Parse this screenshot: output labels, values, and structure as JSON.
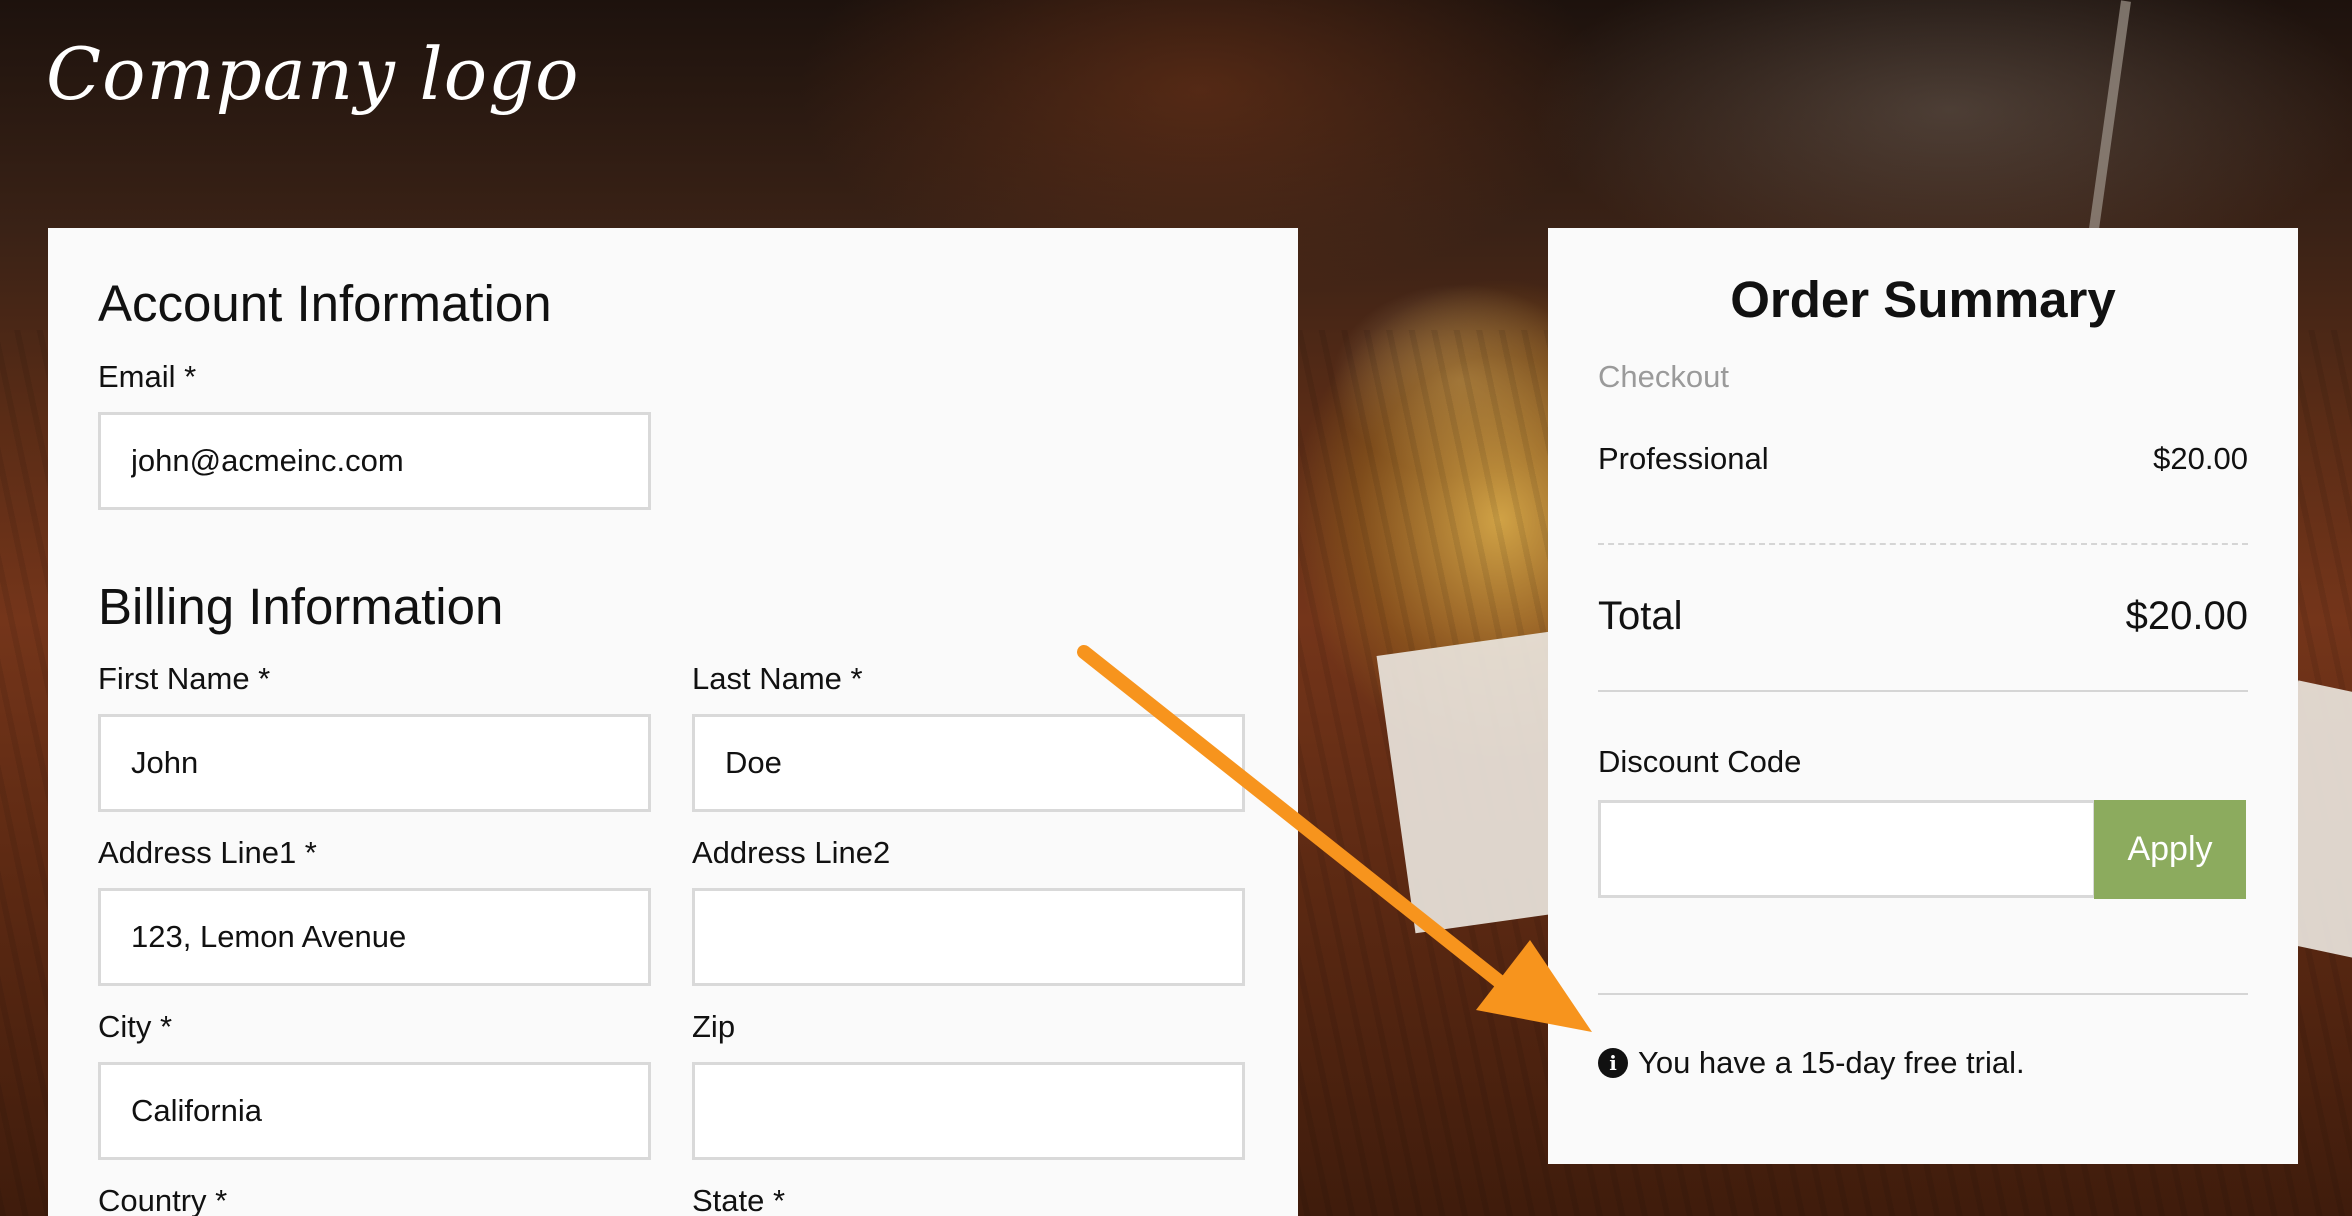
{
  "brand": {
    "logo_text": "Company logo"
  },
  "account": {
    "title": "Account Information",
    "email_label": "Email *",
    "email_value": "john@acmeinc.com"
  },
  "billing": {
    "title": "Billing Information",
    "first_name_label": "First Name *",
    "first_name_value": "John",
    "last_name_label": "Last Name *",
    "last_name_value": "Doe",
    "address1_label": "Address Line1 *",
    "address1_value": "123, Lemon Avenue",
    "address2_label": "Address Line2",
    "address2_value": "",
    "city_label": "City *",
    "city_value": "California",
    "zip_label": "Zip",
    "zip_value": "",
    "country_label": "Country *",
    "state_label": "State *"
  },
  "order": {
    "title": "Order Summary",
    "subtitle": "Checkout",
    "item_name": "Professional",
    "item_price": "$20.00",
    "total_label": "Total",
    "total_value": "$20.00",
    "discount_label": "Discount Code",
    "discount_value": "",
    "apply_label": "Apply",
    "trial_notice": "You have a 15-day free trial.",
    "info_icon_glyph": "i"
  },
  "colors": {
    "apply_button": "#8cab5e",
    "annotation_arrow": "#f7941d"
  }
}
